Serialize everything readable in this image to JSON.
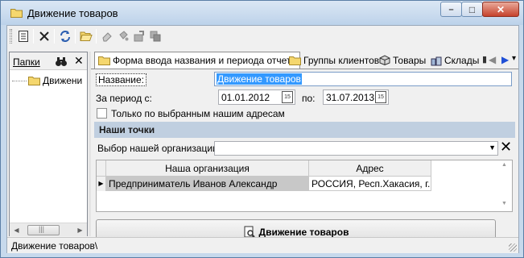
{
  "window": {
    "title": "Движение товаров",
    "controls": {
      "minimize": "–",
      "maximize": "□",
      "close": "✕"
    }
  },
  "toolbar": {
    "icons": [
      "properties-icon",
      "delete-icon",
      "refresh-icon",
      "open-folder-icon",
      "eraser-icon",
      "bucket-icon",
      "stamp-icon",
      "copy-icon"
    ]
  },
  "left_panel": {
    "title": "Папки",
    "find_icon": "binoculars-icon",
    "close": "✕",
    "tree_item": "Движени",
    "hscroll": {
      "left": "◀",
      "right": "▶",
      "grip": "|||"
    }
  },
  "tabs": [
    {
      "label": "Форма ввода названия и периода отчета",
      "icon": "folder-icon",
      "active": true
    },
    {
      "label": "Группы клиентов",
      "icon": "folder-icon",
      "active": false
    },
    {
      "label": "Товары",
      "icon": "box-icon",
      "active": false
    },
    {
      "label": "Склады",
      "icon": "warehouse-icon",
      "active": false
    }
  ],
  "tab_nav": {
    "prev": "◀",
    "next": "▶",
    "menu": "▾"
  },
  "form": {
    "name_label": "Название:",
    "name_value": "Движение товаров",
    "period_label": "За период с:",
    "date_from": "01.01.2012",
    "to_label": "по:",
    "date_to": "31.07.2013",
    "cal_text": "15",
    "only_selected_label": "Только по выбранным нашим адресам",
    "only_selected_checked": false,
    "section_title": "Наши точки",
    "org_select_label": "Выбор нашей организации:",
    "org_select_value": "",
    "combo_arrow": "▼",
    "clear_glyph": "✕"
  },
  "grid": {
    "columns": [
      "Наша организация",
      "Адрес"
    ],
    "row_indicator": "▶",
    "rows": [
      {
        "org": "Предприниматель Иванов Александр",
        "address": "РОССИЯ, Респ.Хакасия, г.Са"
      }
    ],
    "scroll_up": "▲",
    "scroll_down": "▼"
  },
  "action_button": "Движение товаров",
  "status": "Движение товаров\\",
  "colors": {
    "selection": "#3399ff",
    "section_header": "#c0cfe0",
    "title_bar": "#c7d9ec"
  }
}
